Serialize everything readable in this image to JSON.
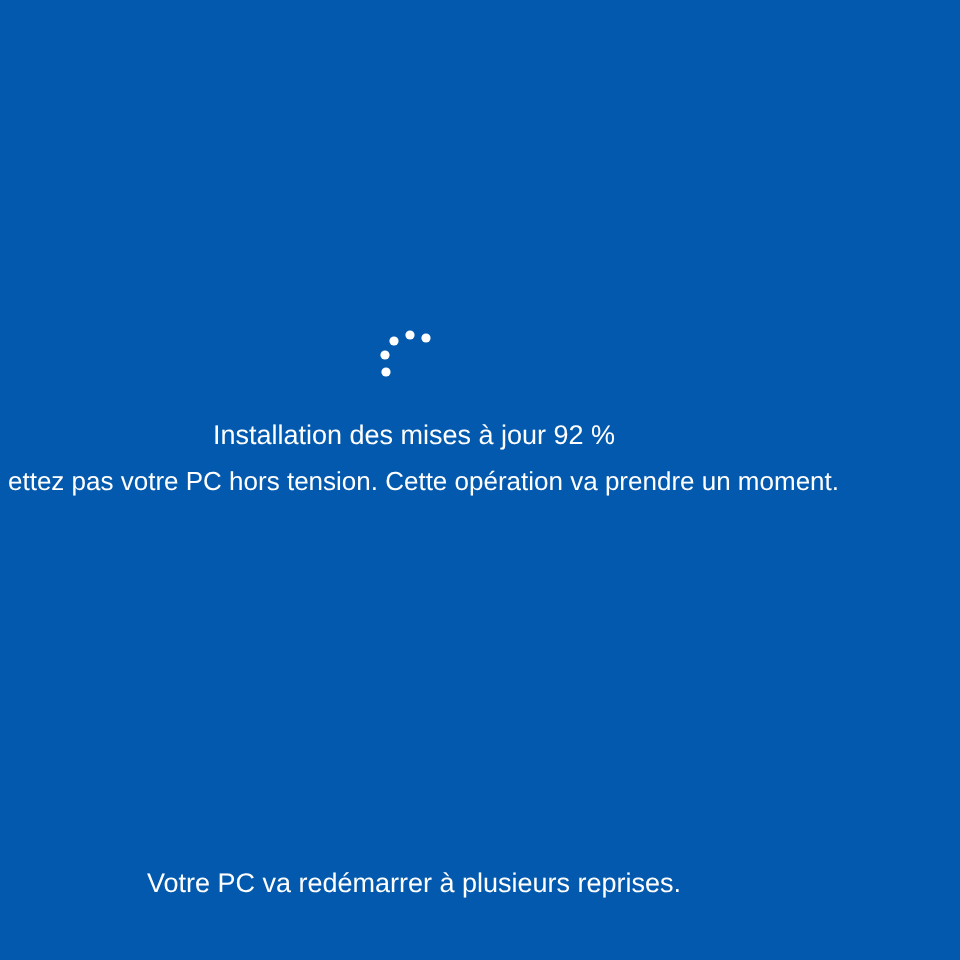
{
  "status": "Installation des mises à jour 92 %",
  "warning": "ettez pas votre PC hors tension. Cette opération va prendre un moment.",
  "footer": "Votre PC va redémarrer à plusieurs reprises."
}
